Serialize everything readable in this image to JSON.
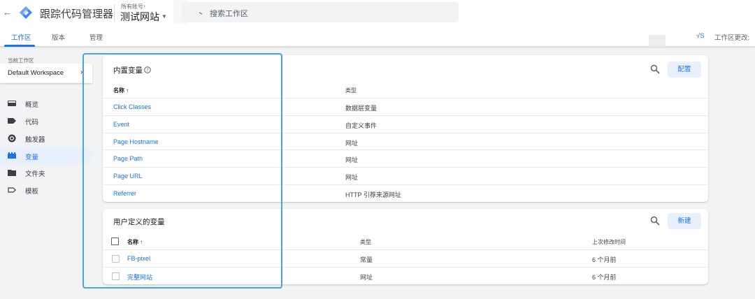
{
  "header": {
    "app_title": "跟踪代码管理器",
    "account_label": "所有账号",
    "account_arrow": "›",
    "container_name": "测试网站",
    "search_placeholder": "搜索工作区"
  },
  "tabs": [
    {
      "label": "工作区",
      "active": true
    },
    {
      "label": "版本",
      "active": false
    },
    {
      "label": "管理",
      "active": false
    }
  ],
  "tab_right": {
    "link": "√S",
    "status": "工作区更改:"
  },
  "sidebar": {
    "workspace_label": "当前工作区",
    "workspace_name": "Default Workspace",
    "items": [
      {
        "label": "概览",
        "icon": "overview-icon",
        "active": false
      },
      {
        "label": "代码",
        "icon": "tag-icon",
        "active": false
      },
      {
        "label": "触发器",
        "icon": "trigger-icon",
        "active": false
      },
      {
        "label": "变量",
        "icon": "variables-icon",
        "active": true
      },
      {
        "label": "文件夹",
        "icon": "folder-icon",
        "active": false
      },
      {
        "label": "模板",
        "icon": "template-icon",
        "active": false
      }
    ]
  },
  "builtin": {
    "title": "内置变量",
    "button": "配置",
    "col_name": "名称 ↑",
    "col_type": "类型",
    "rows": [
      {
        "name": "Click Classes",
        "type": "数据层变量"
      },
      {
        "name": "Event",
        "type": "自定义事件"
      },
      {
        "name": "Page Hostname",
        "type": "网址"
      },
      {
        "name": "Page Path",
        "type": "网址"
      },
      {
        "name": "Page URL",
        "type": "网址"
      },
      {
        "name": "Referrer",
        "type": "HTTP 引荐来源网址"
      }
    ]
  },
  "user_defined": {
    "title": "用户定义的变量",
    "button": "新建",
    "col_name": "名称 ↑",
    "col_type": "类型",
    "col_modified": "上次修改时间",
    "rows": [
      {
        "name": "FB-pixel",
        "type": "常量",
        "modified": "6 个月前"
      },
      {
        "name": "完整网站",
        "type": "网址",
        "modified": "6 个月前"
      }
    ]
  },
  "colors": {
    "accent": "#1a73e8",
    "highlight": "#4aa3df"
  }
}
